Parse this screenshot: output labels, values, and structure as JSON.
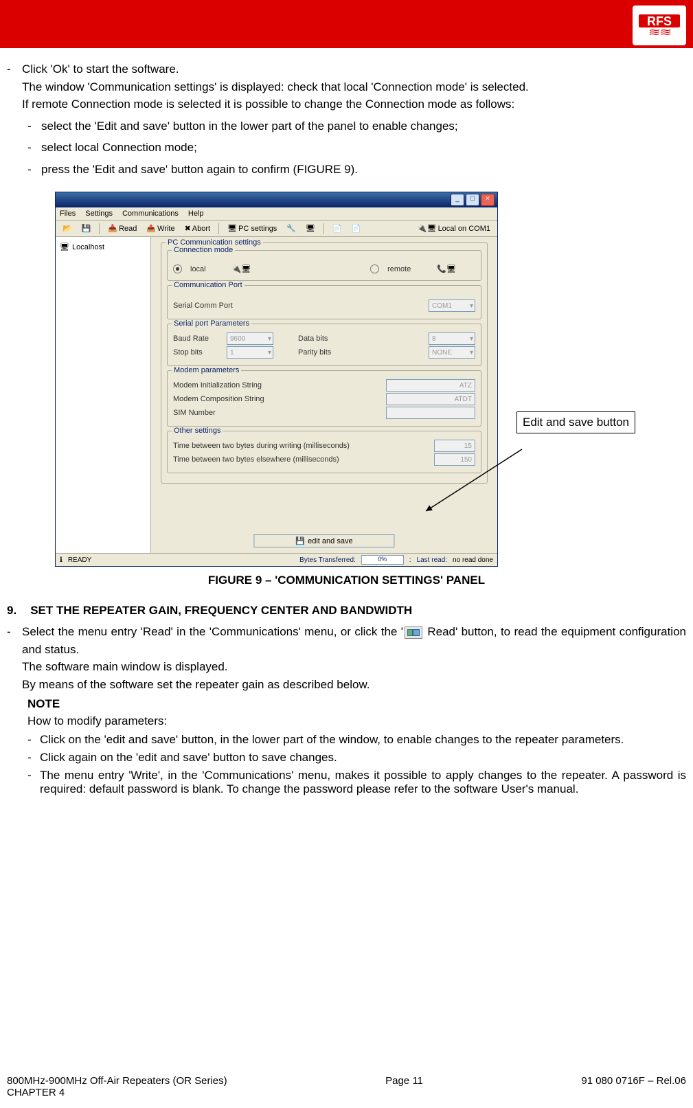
{
  "logo": "RFS",
  "outer_list": {
    "l1": "Click 'Ok' to start the software.",
    "l1b": "The window 'Communication settings' is displayed: check that local 'Connection mode' is selected.",
    "l1c": "If remote Connection mode is selected it is possible to change the Connection mode as follows:"
  },
  "inner_list": {
    "i1": "select the 'Edit and save' button in the lower part of the panel to enable changes;",
    "i2": "select local Connection mode;",
    "i3": "press the 'Edit and save' button again to confirm (FIGURE 9)."
  },
  "app": {
    "menus": {
      "files": "Files",
      "settings": "Settings",
      "comm": "Communications",
      "help": "Help"
    },
    "toolbar": {
      "read": "Read",
      "write": "Write",
      "abort": "Abort",
      "pcsettings": "PC settings",
      "localon": "Local on COM1"
    },
    "tree": {
      "root": "Localhost"
    },
    "group_pc_title": "PC Communication settings",
    "group_conn_title": "Connection mode",
    "conn_local": "local",
    "conn_remote": "remote",
    "group_port_title": "Communication Port",
    "serial_comm_port": "Serial Comm Port",
    "com_val": "COM1",
    "group_serial_title": "Serial port Parameters",
    "baud": "Baud Rate",
    "baud_val": "9600",
    "databits": "Data bits",
    "databits_val": "8",
    "stopbits": "Stop bits",
    "stopbits_val": "1",
    "parity": "Parity bits",
    "parity_val": "NONE",
    "group_modem_title": "Modem parameters",
    "modem_init": "Modem Initialization String",
    "modem_init_val": "ATZ",
    "modem_comp": "Modem Composition String",
    "modem_comp_val": "ATDT",
    "sim": "SIM Number",
    "group_other_title": "Other settings",
    "t1": "Time between two bytes during writing (milliseconds)",
    "t1_val": "15",
    "t2": "Time between two bytes elsewhere (milliseconds)",
    "t2_val": "150",
    "editsave": "edit and save",
    "status_ready": "READY",
    "status_bytes": "Bytes Transferred:",
    "status_pct": "0%",
    "status_lastread": "Last read:",
    "status_noread": "no read done"
  },
  "callout": "Edit and save button",
  "figure_caption": "FIGURE 9 – 'COMMUNICATION SETTINGS' PANEL",
  "section9_num": "9.",
  "section9_title": "SET THE REPEATER GAIN, FREQUENCY CENTER AND BANDWIDTH",
  "s9_l1a": "Select the menu entry 'Read' in the 'Communications' menu, or click the '",
  "s9_l1b": " Read' button, to read the equipment configuration and status.",
  "s9_l2": "The software main window is displayed.",
  "s9_l3": "By means of the software set the repeater gain as described below.",
  "note_head": "NOTE",
  "note_intro": "How to modify parameters:",
  "note_list": {
    "n1": "Click on the 'edit and save' button, in the lower part of the window, to enable changes to the repeater parameters.",
    "n2": "Click again on the 'edit and save' button to save changes.",
    "n3": "The menu entry 'Write', in the 'Communications' menu, makes it possible to apply changes to the repeater. A password is required: default password is blank. To change the password please refer to the software User's manual."
  },
  "footer": {
    "left1": "800MHz-900MHz Off-Air Repeaters (OR Series)",
    "left2": "CHAPTER 4",
    "center_lbl": "Page",
    "center_num": "11",
    "right": "91 080 0716F – Rel.06"
  }
}
